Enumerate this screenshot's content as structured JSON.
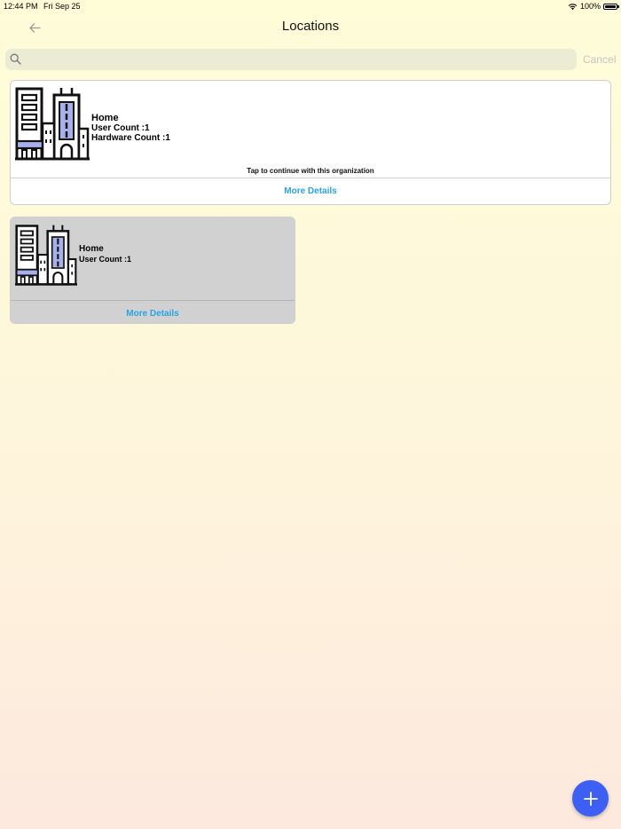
{
  "status_bar": {
    "time": "12:44 PM",
    "date": "Fri Sep 25",
    "battery": "100%"
  },
  "nav": {
    "title": "Locations",
    "back_icon": "arrow-left-icon"
  },
  "search": {
    "placeholder": "",
    "value": "",
    "cancel_label": "Cancel"
  },
  "organization_card": {
    "name": "Home",
    "user_count": "User Count :1",
    "hardware_count": "Hardware Count :1",
    "hint": "Tap to continue with this organization",
    "more_details": "More Details"
  },
  "location_card": {
    "name": "Home",
    "user_count": "User Count :1",
    "more_details": "More Details"
  },
  "fab": {
    "icon": "plus-icon"
  },
  "colors": {
    "accent_blue": "#29a3e8",
    "fab_blue": "#3e5ff3",
    "building_accent": "#a7b0ea",
    "background_top": "#fefdd8",
    "background_bottom": "#fde9de"
  }
}
